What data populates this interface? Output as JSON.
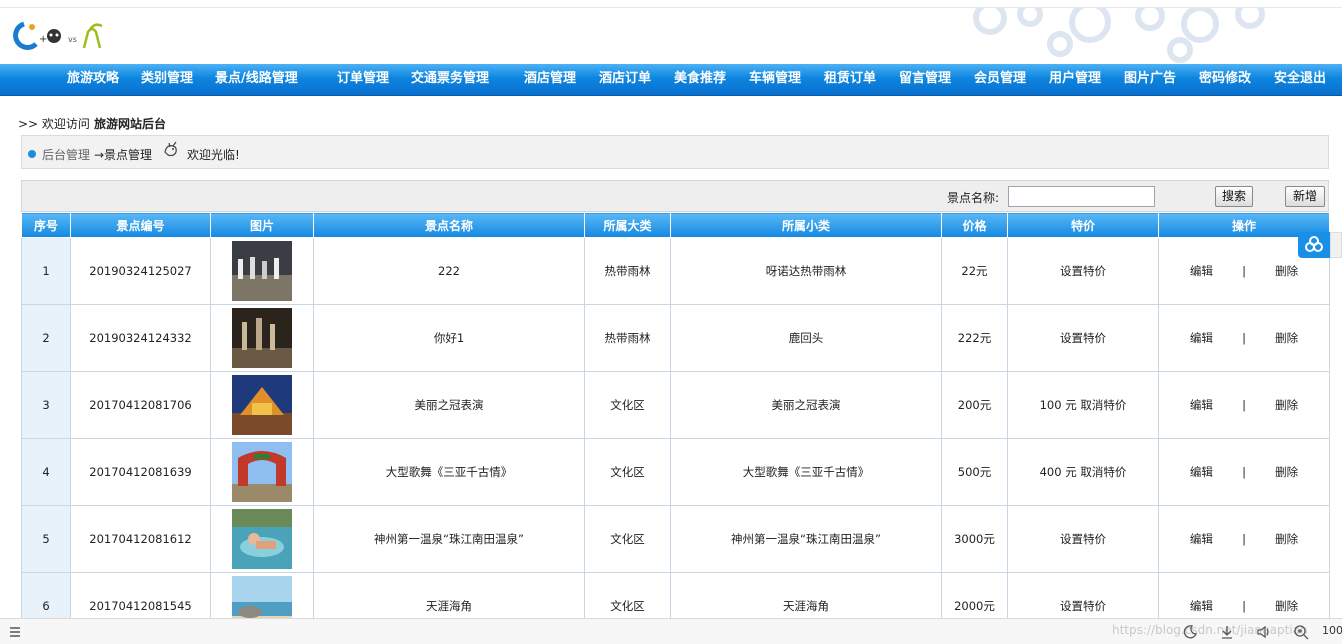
{
  "nav": {
    "items": [
      "旅游攻略",
      "类别管理",
      "景点/线路管理",
      "订单管理",
      "交通票务管理",
      "酒店管理",
      "酒店订单",
      "美食推荐",
      "车辆管理",
      "租赁订单",
      "留言管理",
      "会员管理",
      "用户管理",
      "图片广告",
      "密码修改",
      "安全退出"
    ]
  },
  "welcome": {
    "prefix": ">> 欢迎访问",
    "site": "旅游网站后台"
  },
  "breadcrumb": {
    "root": "后台管理",
    "current": "→景点管理",
    "greeting": "欢迎光临!"
  },
  "search": {
    "label": "景点名称:",
    "value": "",
    "search_label": "搜索",
    "add_label": "新增"
  },
  "table": {
    "headers": [
      "序号",
      "景点编号",
      "图片",
      "景点名称",
      "所属大类",
      "所属小类",
      "价格",
      "特价",
      "操作"
    ],
    "edit_label": "编辑",
    "sep": "|",
    "delete_label": "删除",
    "rows": [
      {
        "idx": "1",
        "code": "20190324125027",
        "name": "222",
        "major": "热带雨林",
        "minor": "呀诺达热带雨林",
        "price": "22元",
        "special": "设置特价"
      },
      {
        "idx": "2",
        "code": "20190324124332",
        "name": "你好1",
        "major": "热带雨林",
        "minor": "鹿回头",
        "price": "222元",
        "special": "设置特价"
      },
      {
        "idx": "3",
        "code": "20170412081706",
        "name": "美丽之冠表演",
        "major": "文化区",
        "minor": "美丽之冠表演",
        "price": "200元",
        "special": "100 元  取消特价"
      },
      {
        "idx": "4",
        "code": "20170412081639",
        "name": "大型歌舞《三亚千古情》",
        "major": "文化区",
        "minor": "大型歌舞《三亚千古情》",
        "price": "500元",
        "special": "400 元  取消特价"
      },
      {
        "idx": "5",
        "code": "20170412081612",
        "name": "神州第一温泉“珠江南田温泉”",
        "major": "文化区",
        "minor": "神州第一温泉“珠江南田温泉”",
        "price": "3000元",
        "special": "设置特价"
      },
      {
        "idx": "6",
        "code": "20170412081545",
        "name": "天涯海角",
        "major": "文化区",
        "minor": "天涯海角",
        "price": "2000元",
        "special": "设置特价"
      }
    ]
  },
  "statusbar": {
    "watermark": "https://blog.csdn.net/jiangaptian",
    "zoom": "100"
  },
  "colors": {
    "nav": "#0d86e0",
    "header_cell": "#1388e0",
    "index_cell": "#e7f2fb"
  }
}
